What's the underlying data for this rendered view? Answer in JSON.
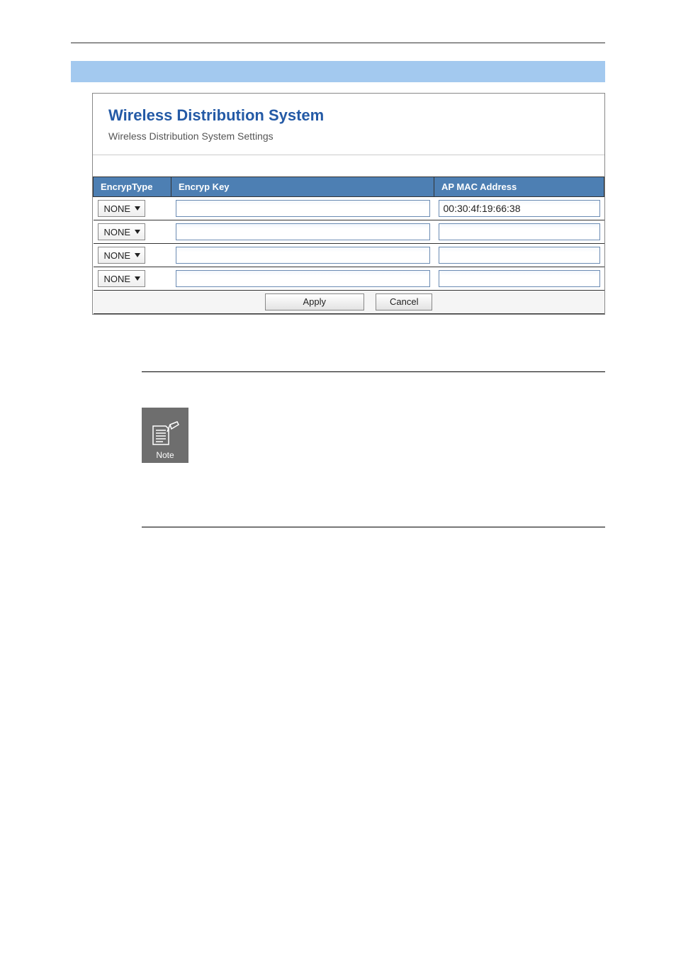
{
  "panel": {
    "title": "Wireless Distribution System",
    "subtitle": "Wireless Distribution System Settings"
  },
  "table": {
    "headers": {
      "encrypType": "EncrypType",
      "encrypKey": "Encryp Key",
      "apMac": "AP MAC Address"
    },
    "rows": [
      {
        "encrypType": "NONE",
        "encrypKey": "",
        "apMac": "00:30:4f:19:66:38"
      },
      {
        "encrypType": "NONE",
        "encrypKey": "",
        "apMac": ""
      },
      {
        "encrypType": "NONE",
        "encrypKey": "",
        "apMac": ""
      },
      {
        "encrypType": "NONE",
        "encrypKey": "",
        "apMac": ""
      }
    ]
  },
  "buttons": {
    "apply": "Apply",
    "cancel": "Cancel"
  },
  "noteIcon": {
    "label": "Note"
  }
}
